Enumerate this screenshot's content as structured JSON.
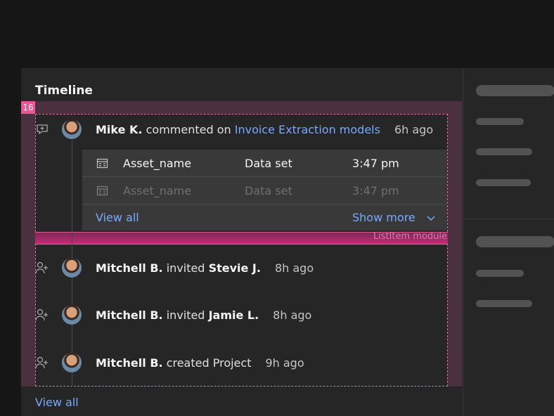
{
  "timeline": {
    "title": "Timeline",
    "spacing_badge": "16",
    "module_label": "ListItem module",
    "view_all": "View all",
    "items": [
      {
        "actor": "Mike K.",
        "action": "commented on",
        "target": "Invoice Extraction models",
        "time": "6h ago",
        "icon": "add-comment-icon"
      },
      {
        "actor": "Mitchell B.",
        "action": "invited",
        "target": "Stevie J.",
        "time": "8h ago",
        "icon": "user-add-icon"
      },
      {
        "actor": "Mitchell B.",
        "action": "invited",
        "target": "Jamie L.",
        "time": "8h ago",
        "icon": "user-add-icon"
      },
      {
        "actor": "Mitchell B.",
        "action": "created Project",
        "target": "",
        "time": "9h ago",
        "icon": "user-add-icon"
      }
    ],
    "assets": [
      {
        "name": "Asset_name",
        "type": "Data set",
        "time": "3:47 pm",
        "icon": "table-icon"
      },
      {
        "name": "Asset_name",
        "type": "Data set",
        "time": "3:47 pm",
        "icon": "table-icon"
      }
    ],
    "assets_footer": {
      "view_all": "View all",
      "show_more": "Show more"
    }
  },
  "colors": {
    "accent": "#78a9ff",
    "highlight": "#ee5396",
    "panel": "#262626"
  }
}
